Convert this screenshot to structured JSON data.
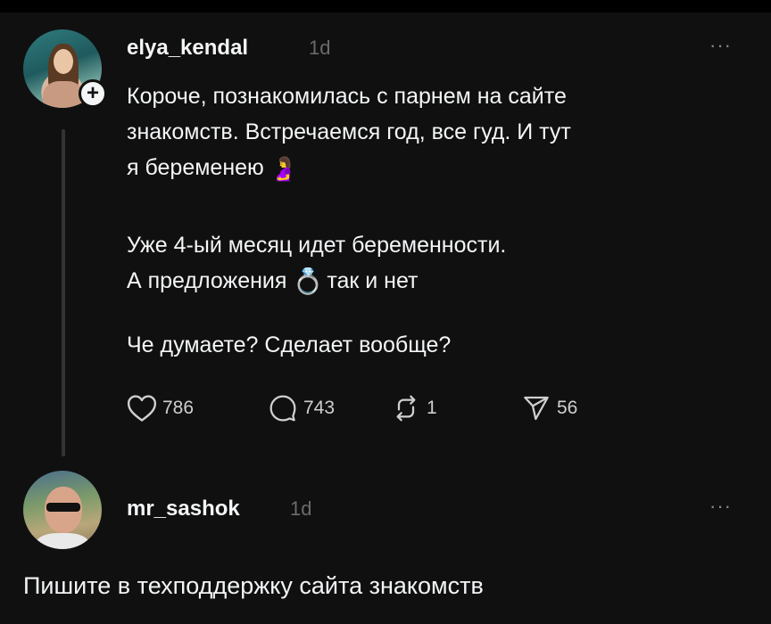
{
  "post": {
    "username": "elya_kendal",
    "time": "1d",
    "line1": "Короче, познакомилась с парнем на сайте",
    "line2": "знакомств. Встречаемся год, все гуд. И тут",
    "line3": "я беременею",
    "line3_emoji": "🤰",
    "line4": "Уже 4-ый месяц идет беременности.",
    "line5_a": "А предложения",
    "line5_emoji": "💍",
    "line5_b": "так и нет",
    "line6": "Че думаете? Сделает вообще?",
    "likes": "786",
    "comments": "743",
    "reposts": "1",
    "shares": "56"
  },
  "reply": {
    "username": "mr_sashok",
    "time": "1d",
    "text": "Пишите в техподдержку сайта знакомств"
  },
  "ui": {
    "more_glyph": "···",
    "follow_glyph": "+"
  }
}
